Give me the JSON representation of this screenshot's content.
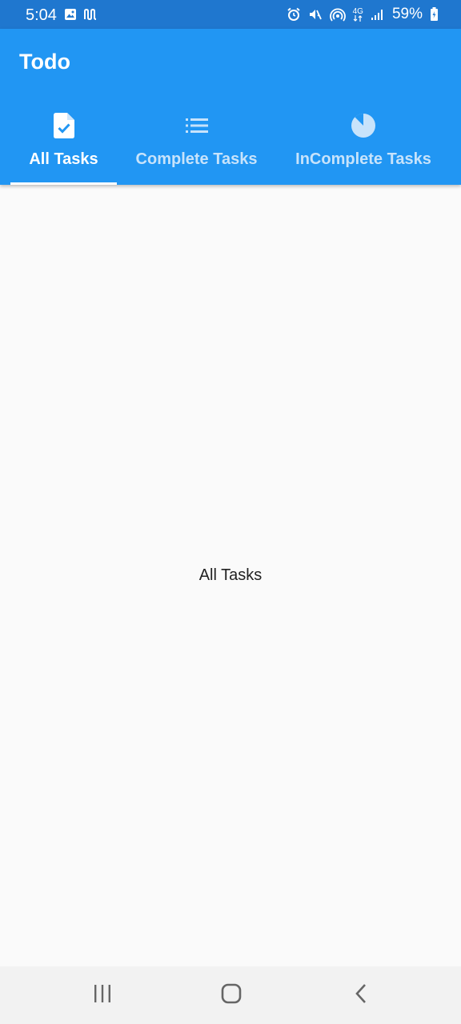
{
  "status_bar": {
    "time": "5:04",
    "network": "4G",
    "battery": "59%"
  },
  "app": {
    "title": "Todo"
  },
  "tabs": [
    {
      "label": "All Tasks",
      "icon": "task-check-icon",
      "active": true
    },
    {
      "label": "Complete Tasks",
      "icon": "list-icon",
      "active": false
    },
    {
      "label": "InComplete Tasks",
      "icon": "pie-chart-icon",
      "active": false
    }
  ],
  "main": {
    "content_text": "All Tasks"
  },
  "colors": {
    "status_bar": "#1f77cf",
    "app_bar": "#2196f3",
    "inactive_tab": "#c7e3fb",
    "background": "#fafafa"
  }
}
